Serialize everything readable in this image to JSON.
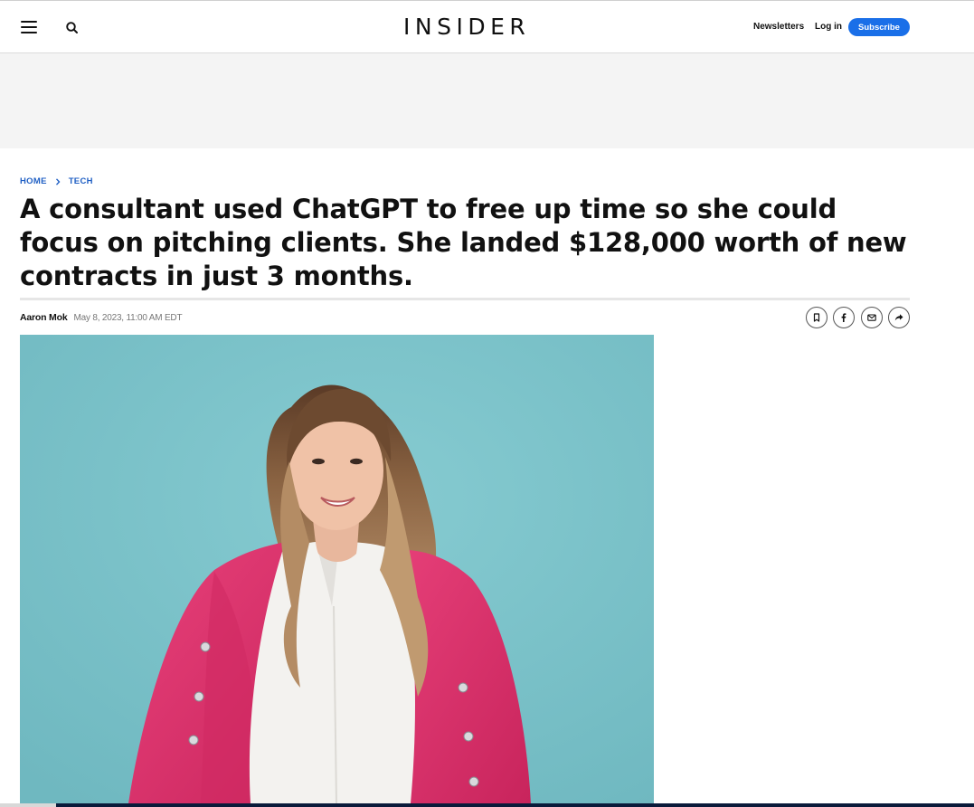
{
  "header": {
    "logo": "INSIDER",
    "newsletters_label": "Newsletters",
    "login_label": "Log in",
    "subscribe_label": "Subscribe"
  },
  "breadcrumb": [
    "HOME",
    "TECH"
  ],
  "article": {
    "headline": "A consultant used ChatGPT to free up time so she could focus on pitching clients. She landed $128,000 worth of new contracts in just 3 months.",
    "author": "Aaron Mok",
    "date": "May 8, 2023, 11:00 AM EDT"
  },
  "share_icons": [
    "bookmark-icon",
    "facebook-icon",
    "email-icon",
    "share-forward-icon"
  ],
  "colors": {
    "accent": "#1a6fe8",
    "breadcrumb": "#1f5fc4",
    "photo_background": "#79c1c8",
    "blazer": "#e2336f"
  }
}
